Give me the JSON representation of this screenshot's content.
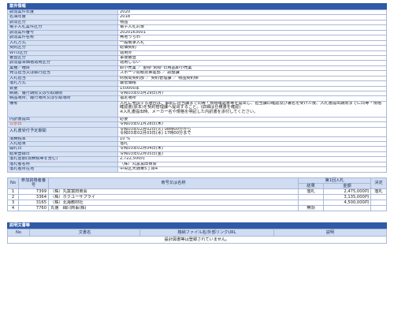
{
  "section_title": "案件情報",
  "fields": [
    {
      "label": "調達案件年度",
      "value": "2020"
    },
    {
      "label": "名簿年度",
      "value": "2018"
    },
    {
      "label": "調達区分",
      "value": "物品"
    },
    {
      "label": "電子入札案件区分",
      "value": "電子入札対象"
    },
    {
      "label": "調達案件番号",
      "value": "2020163001"
    },
    {
      "label": "調達案件名称",
      "value": "無地うちわ"
    },
    {
      "label": "入札方式",
      "value": "一般競争入札"
    },
    {
      "label": "契約区分",
      "value": "総価契約"
    },
    {
      "label": "WTO区分",
      "value": "適用外"
    },
    {
      "label": "審査区分",
      "value": "事後審査"
    },
    {
      "label": "調達基準価格適用区分",
      "value": "適用しない"
    },
    {
      "label": "業種／種目",
      "value": "卸小売業 ／ 金物･荒物･日用品卸小売業"
    },
    {
      "label": "発注担当又は執行担当",
      "value": "スポーツ局競技推進部 ／ 調整課"
    },
    {
      "label": "入札担当",
      "value": "財務局契約部 ／ 契約管理課 ／ 物品契約係"
    },
    {
      "label": "落札方式",
      "value": "最低価格"
    },
    {
      "label": "数量",
      "value": "150000本"
    },
    {
      "label": "納期、履行期限又は引取期限",
      "value": "令和03年03月29日(月)"
    },
    {
      "label": "納品場所、履行場所又は引取場所",
      "value": "指定場所"
    },
    {
      "label": "備考",
      "value": "入札に参加する場合は、事前に担当課まで同等・規格確認書等を提出し、担当課の確認及び署名を受けた後、入札書提出期限までに同等・規格確認書(原本)を契約管理課へ提出すること。(詳細は仕様書を確認)\n※入札書提出時、メーカー名や規格を明記した内訳書を添付してください。",
      "tall": true
    },
    {
      "label": "内訳書提出",
      "value": "必要"
    },
    {
      "label": "公示日",
      "value": "令和03年01月28日(木)",
      "hl": true
    },
    {
      "label": "入札書受付予定期間",
      "value": "令和03年02月02日(火) 08時00分から\n令和03年02月03日(水) 17時00分まで",
      "tall2": true
    },
    {
      "label": "消費税率",
      "value": "10 %"
    },
    {
      "label": "入札結果",
      "value": "落札"
    },
    {
      "label": "開札日",
      "value": "令和03年02月04日(木)"
    },
    {
      "label": "結果登録日",
      "value": "令和03年02月05日(金)"
    },
    {
      "label": "落札金額(消費税等を含む)",
      "value": "2,722,500円"
    },
    {
      "label": "落札者名称",
      "value": "（株）丸富富田商会"
    },
    {
      "label": "落札者所在地",
      "value": "中央区大通東5丁目4"
    }
  ],
  "results": {
    "headers": {
      "no": "No",
      "number": "参加資格者番号",
      "name": "商号又は名称",
      "round": "第1回入札",
      "remark": "結果",
      "amount": "金額",
      "decision": "決定"
    },
    "rows": [
      {
        "no": "1",
        "number": "7399",
        "name": "（株）丸富富田商会",
        "remark": "落札",
        "amount": "2,475,000円",
        "decision": "落札"
      },
      {
        "no": "2",
        "number": "3364",
        "name": "（株）ホクユーサプライ",
        "remark": "",
        "amount": "3,135,000円",
        "decision": ""
      },
      {
        "no": "3",
        "number": "3165",
        "name": "（株）北海教材社",
        "remark": "",
        "amount": "4,500,000円",
        "decision": ""
      },
      {
        "no": "4",
        "number": "7760",
        "name": "丸徳　細川商事(株)",
        "remark": "無効",
        "amount": "",
        "decision": ""
      }
    ]
  },
  "docs": {
    "title": "説明文書等",
    "headers": {
      "no": "No",
      "doc": "文書名",
      "file": "格納ファイル名/外部リンクURL",
      "desc": "説明"
    },
    "empty": "設計図書等は登録されていません。"
  }
}
